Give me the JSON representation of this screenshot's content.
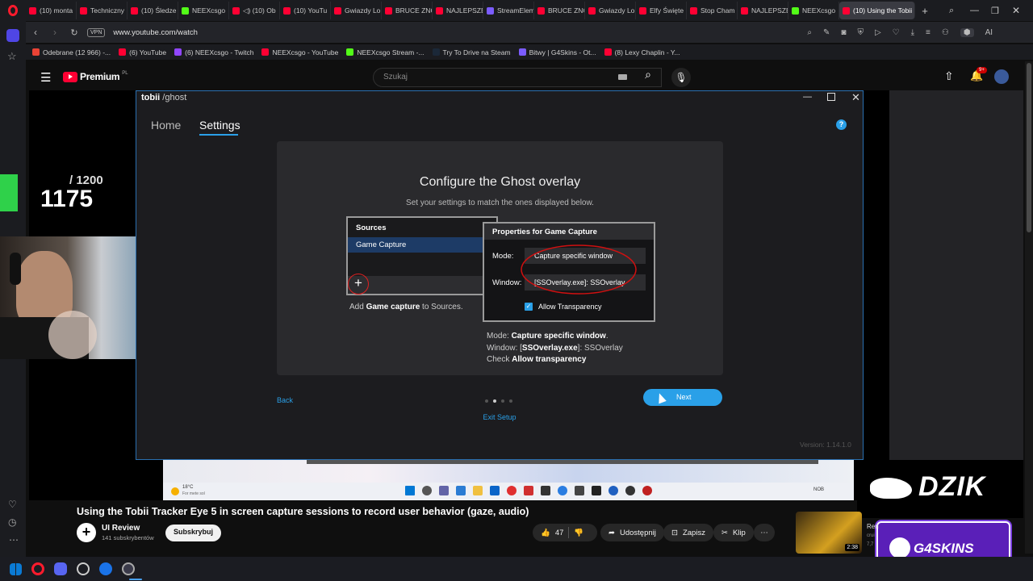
{
  "browser": {
    "tabs": [
      {
        "label": "(10) monta",
        "color": "#ff0033"
      },
      {
        "label": "Techniczny",
        "color": "#ff0033"
      },
      {
        "label": "(10) Śledze",
        "color": "#ff0033"
      },
      {
        "label": "NEEXcsgo",
        "color": "#53fc18"
      },
      {
        "label": "◁) (10) Ob",
        "color": "#ff0033"
      },
      {
        "label": "(10) YouTu",
        "color": "#ff0033"
      },
      {
        "label": "Gwiazdy Lo",
        "color": "#ff0033"
      },
      {
        "label": "BRUCE ZNC",
        "color": "#ff0033"
      },
      {
        "label": "NAJLEPSZE",
        "color": "#ff0033"
      },
      {
        "label": "StreamElem",
        "color": "#7b5cff"
      },
      {
        "label": "BRUCE ZNC",
        "color": "#ff0033"
      },
      {
        "label": "Gwiazdy Lo",
        "color": "#ff0033"
      },
      {
        "label": "Elfy Święte",
        "color": "#ff0033"
      },
      {
        "label": "Stop Cham",
        "color": "#ff0033"
      },
      {
        "label": "NAJLEPSZE",
        "color": "#ff0033"
      },
      {
        "label": "NEEXcsgo",
        "color": "#53fc18"
      },
      {
        "label": "(10) Using the Tobii",
        "color": "#ff0033"
      }
    ],
    "vpn_label": "VPN",
    "url": "www.youtube.com/watch",
    "bookmarks": [
      {
        "label": "Odebrane (12 966) -...",
        "color": "#ea4335"
      },
      {
        "label": "(6) YouTube",
        "color": "#ff0033"
      },
      {
        "label": "(6) NEEXcsgo - Twitch",
        "color": "#9146ff"
      },
      {
        "label": "NEEXcsgo - YouTube",
        "color": "#ff0033"
      },
      {
        "label": "NEEXcsgo Stream -...",
        "color": "#53fc18"
      },
      {
        "label": "Try To Drive na Steam",
        "color": "#1b2838"
      },
      {
        "label": "Bitwy | G4Skins - Ot...",
        "color": "#7b5cff"
      },
      {
        "label": "(8) Lexy Chaplin - Y...",
        "color": "#ff0033"
      }
    ],
    "ai_label": "AI"
  },
  "youtube": {
    "logo": "Premium",
    "logo_sup": "PL",
    "search_placeholder": "Szukaj",
    "notif_badge": "9+",
    "video_title": "Using the Tobii Tracker Eye 5 in screen capture sessions to record user behavior (gaze, audio)",
    "channel_name": "UI Review",
    "subscribers": "141 subskrybentów",
    "subscribe_label": "Subskrybuj",
    "likes": "47",
    "share_label": "Udostępnij",
    "save_label": "Zapisz",
    "clip_label": "Klip",
    "sidebar_video_time": "2:38",
    "sidebar_video_text": "Ren",
    "sidebar_video_sub": "crui",
    "sidebar_video_sub2": "7,7"
  },
  "overlay": {
    "counter_total": "/ 1200",
    "counter_value": "1175",
    "dzik": "DZIK",
    "g4skins": "G4SKINS"
  },
  "tobii": {
    "brand": "tobii",
    "product": "/ghost",
    "nav_home": "Home",
    "nav_settings": "Settings",
    "help": "?",
    "heading": "Configure the Ghost overlay",
    "subheading": "Set your settings to match the ones displayed below.",
    "sources_title": "Sources",
    "sources_item": "Game Capture",
    "add_prefix": "Add ",
    "add_bold": "Game capture",
    "add_suffix": " to Sources.",
    "props_title": "Properties for Game Capture",
    "mode_label": "Mode:",
    "mode_value": "Capture specific window",
    "window_label": "Window:",
    "window_value": "[SSOverlay.exe]: SSOverlay",
    "allow_transparency": "Allow Transparency",
    "instr_mode_prefix": "Mode: ",
    "instr_mode_bold": "Capture specific window",
    "instr_mode_suffix": ".",
    "instr_window_prefix": "Window: [",
    "instr_window_bold": "SSOverlay.exe",
    "instr_window_suffix": "]: SSOverlay",
    "instr_check_prefix": "Check ",
    "instr_check_bold": "Allow transparency",
    "back": "Back",
    "next": "Next",
    "exit": "Exit Setup",
    "version": "Version: 1.14.1.0"
  },
  "windows_preview": {
    "weather": "18°C",
    "weather_sub": "For mete sol",
    "lang": "NOB"
  }
}
